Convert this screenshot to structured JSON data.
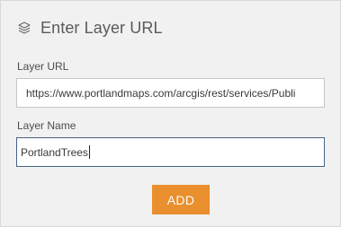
{
  "header": {
    "icon": "layers-icon",
    "title": "Enter Layer URL"
  },
  "layer_url": {
    "label": "Layer URL",
    "value": "https://www.portlandmaps.com/arcgis/rest/services/Publi"
  },
  "layer_name": {
    "label": "Layer Name",
    "value": "PortlandTrees"
  },
  "add_button": {
    "label": "ADD",
    "color": "#e98f2e"
  }
}
